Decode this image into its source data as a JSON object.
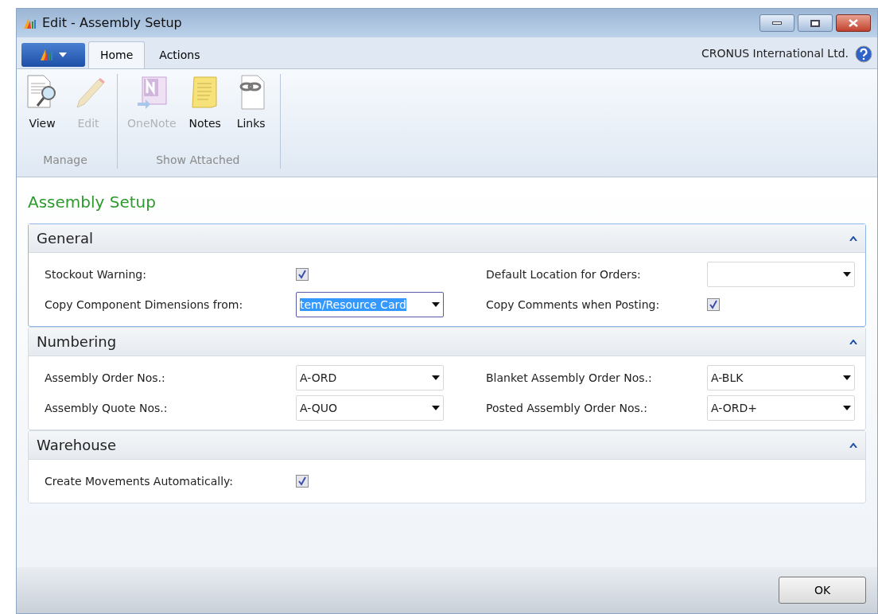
{
  "window": {
    "title": "Edit - Assembly Setup"
  },
  "tabs": [
    {
      "label": "Home",
      "selected": true
    },
    {
      "label": "Actions",
      "selected": false
    }
  ],
  "company": "CRONUS International Ltd.",
  "ribbon": [
    {
      "label": "Manage",
      "buttons": [
        {
          "label": "View",
          "disabled": false
        },
        {
          "label": "Edit",
          "disabled": true
        }
      ]
    },
    {
      "label": "Show Attached",
      "buttons": [
        {
          "label": "OneNote",
          "disabled": true
        },
        {
          "label": "Notes",
          "disabled": false
        },
        {
          "label": "Links",
          "disabled": false
        }
      ]
    }
  ],
  "page_title": "Assembly Setup",
  "sections": [
    {
      "title": "General",
      "expanded": true,
      "focused": true,
      "fields": [
        {
          "label": "Stockout Warning:",
          "kind": "checkbox",
          "checked": true
        },
        {
          "label": "Default Location for Orders:",
          "kind": "dropdown"
        },
        {
          "label": "Copy Component Dimensions from:",
          "kind": "dropdown",
          "value": "tem/Resource Card",
          "selected": true
        },
        {
          "label": "Copy Comments when Posting:",
          "kind": "checkbox",
          "checked": true
        }
      ]
    },
    {
      "title": "Numbering",
      "expanded": true,
      "focused": false,
      "fields": [
        {
          "label": "Assembly Order Nos.:",
          "kind": "dropdown",
          "value": "A-ORD",
          "selected": false
        },
        {
          "label": "Blanket Assembly Order Nos.:",
          "kind": "dropdown",
          "value": "A-BLK",
          "selected": false
        },
        {
          "label": "Assembly Quote Nos.:",
          "kind": "dropdown",
          "value": "A-QUO",
          "selected": false
        },
        {
          "label": "Posted Assembly Order Nos.:",
          "kind": "dropdown",
          "value": "A-ORD+",
          "selected": false
        }
      ]
    },
    {
      "title": "Warehouse",
      "expanded": true,
      "focused": false,
      "fields": [
        {
          "label": "Create Movements Automatically:",
          "kind": "checkbox",
          "checked": true
        }
      ]
    }
  ],
  "buttons": [
    "OK"
  ]
}
